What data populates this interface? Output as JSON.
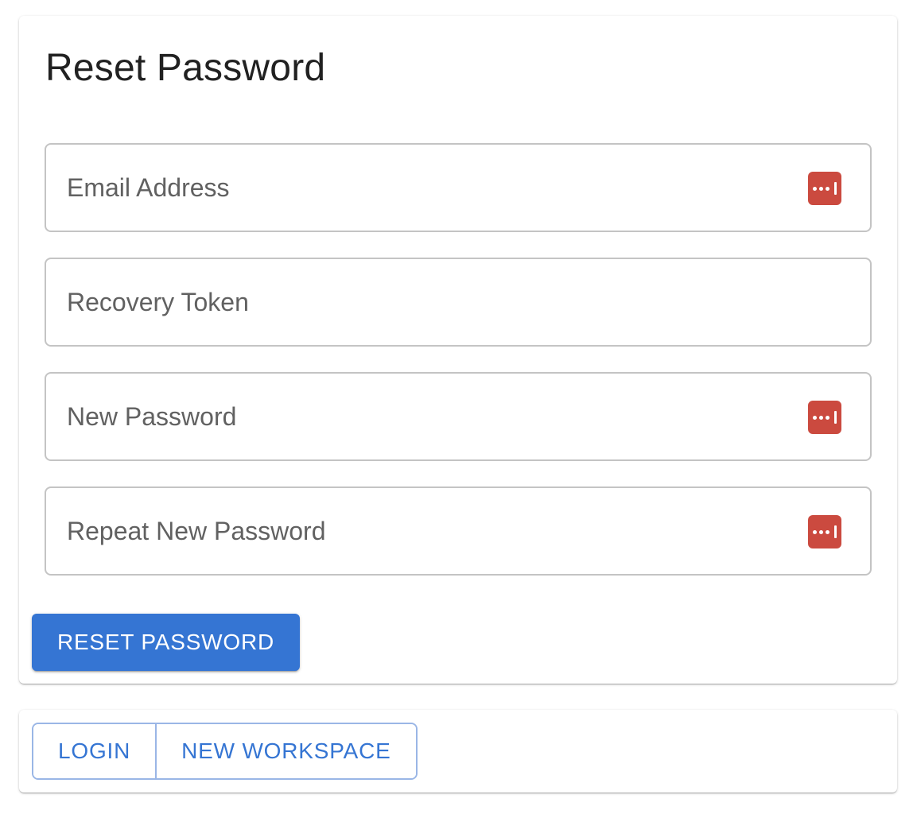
{
  "form": {
    "title": "Reset Password",
    "fields": [
      {
        "placeholder": "Email Address",
        "value": "",
        "has_password_manager_icon": true
      },
      {
        "placeholder": "Recovery Token",
        "value": "",
        "has_password_manager_icon": false
      },
      {
        "placeholder": "New Password",
        "value": "",
        "has_password_manager_icon": true
      },
      {
        "placeholder": "Repeat New Password",
        "value": "",
        "has_password_manager_icon": true
      }
    ],
    "submit_label": "RESET PASSWORD"
  },
  "footer": {
    "login_label": "LOGIN",
    "new_workspace_label": "NEW WORKSPACE"
  },
  "icons": {
    "password_manager": "password-manager-icon"
  },
  "colors": {
    "primary": "#3575d3",
    "password_manager_icon": "#cb4a3f",
    "outline_border": "#9ab6e6",
    "field_border": "#c4c4c4",
    "title_text": "#212121",
    "placeholder_text": "#616161"
  }
}
